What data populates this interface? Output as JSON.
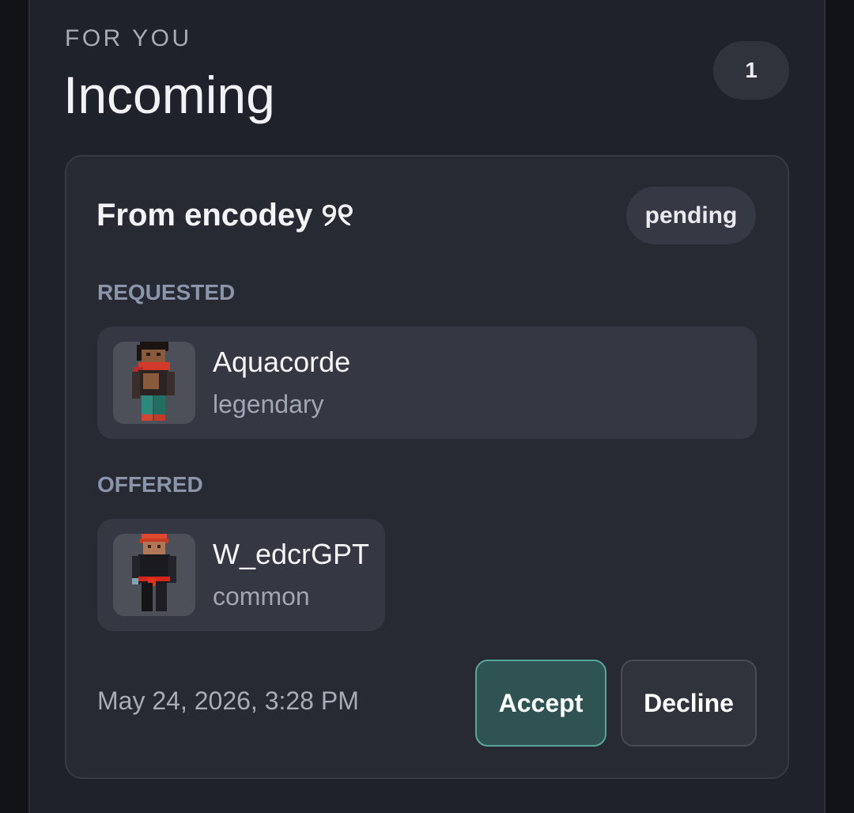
{
  "header": {
    "eyebrow": "FOR YOU",
    "title": "Incoming",
    "count": "1"
  },
  "trade": {
    "from_label": "From encodey ୨୧",
    "status": "pending",
    "requested_label": "REQUESTED",
    "requested_item": {
      "name": "Aquacorde",
      "rarity": "legendary"
    },
    "offered_label": "OFFERED",
    "offered_item": {
      "name": "W_edcrGPT",
      "rarity": "common"
    },
    "timestamp": "May 24, 2026, 3:28 PM",
    "accept_label": "Accept",
    "decline_label": "Decline"
  },
  "colors": {
    "background": "#1f222a",
    "card": "#272a33",
    "accent_accept": "#5aa59a",
    "muted_label": "#8a95aa"
  }
}
